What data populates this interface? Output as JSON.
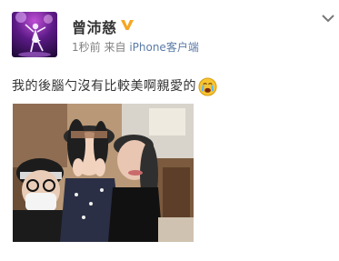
{
  "post": {
    "author": "曾沛慈",
    "time": "1秒前",
    "via": "来自",
    "source": "iPhone客户端",
    "text": "我的後腦勺沒有比較美啊親愛的",
    "emoji_icon": "crying-emoji-icon",
    "verified_icon": "verified-v-icon",
    "menu_icon": "chevron-down-icon",
    "accent_color": "#f5a623",
    "link_color": "#5b7aa6"
  }
}
